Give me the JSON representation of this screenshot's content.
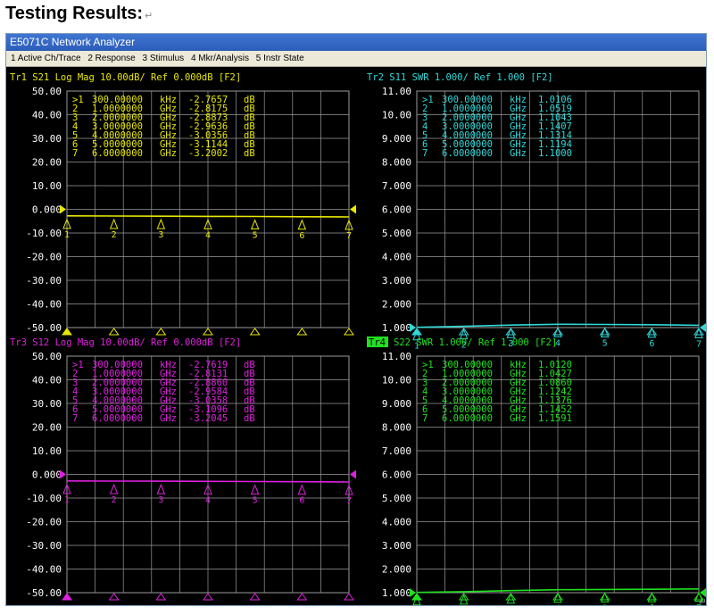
{
  "page": {
    "heading": "Testing Results:",
    "return_mark": "↵"
  },
  "window": {
    "title": "E5071C Network Analyzer"
  },
  "menu": [
    "1 Active Ch/Trace",
    "2 Response",
    "3 Stimulus",
    "4 Mkr/Analysis",
    "5 Instr State"
  ],
  "colors": {
    "tr1": "#e8e800",
    "tr2": "#30d8d8",
    "tr3": "#e020e0",
    "tr4": "#20e020",
    "grid": "#9a9a9a",
    "axis_text": "#ffffff"
  },
  "panels": [
    {
      "id": "tr1",
      "label": "Tr1",
      "header": "Tr1 S21 Log Mag 10.00dB/ Ref 0.000dB [F2]",
      "yticks": [
        "50.00",
        "40.00",
        "30.00",
        "20.00",
        "10.00",
        "0.000",
        "-10.00",
        "-20.00",
        "-30.00",
        "-40.00",
        "-50.00"
      ],
      "ymin": -50,
      "ymax": 50,
      "ref": 0,
      "marker_values": [
        -2.7657,
        -2.8175,
        -2.8873,
        -2.9636,
        -3.0356,
        -3.1144,
        -3.2002
      ],
      "markers": [
        {
          "idx": ">1",
          "freq": "300.00000",
          "unit": "kHz",
          "val": "-2.7657",
          "vunit": "dB"
        },
        {
          "idx": "2",
          "freq": "1.0000000",
          "unit": "GHz",
          "val": "-2.8175",
          "vunit": "dB"
        },
        {
          "idx": "3",
          "freq": "2.0000000",
          "unit": "GHz",
          "val": "-2.8873",
          "vunit": "dB"
        },
        {
          "idx": "4",
          "freq": "3.0000000",
          "unit": "GHz",
          "val": "-2.9636",
          "vunit": "dB"
        },
        {
          "idx": "5",
          "freq": "4.0000000",
          "unit": "GHz",
          "val": "-3.0356",
          "vunit": "dB"
        },
        {
          "idx": "6",
          "freq": "5.0000000",
          "unit": "GHz",
          "val": "-3.1144",
          "vunit": "dB"
        },
        {
          "idx": "7",
          "freq": "6.0000000",
          "unit": "GHz",
          "val": "-3.2002",
          "vunit": "dB"
        }
      ]
    },
    {
      "id": "tr2",
      "label": "Tr2",
      "header": "Tr2 S11 SWR 1.000/ Ref 1.000 [F2]",
      "yticks": [
        "11.00",
        "10.00",
        "9.000",
        "8.000",
        "7.000",
        "6.000",
        "5.000",
        "4.000",
        "3.000",
        "2.000",
        "1.000"
      ],
      "ymin": 1,
      "ymax": 11,
      "ref": 1,
      "marker_values": [
        1.0106,
        1.0519,
        1.1043,
        1.1407,
        1.1314,
        1.1194,
        1.1
      ],
      "markers": [
        {
          "idx": ">1",
          "freq": "300.00000",
          "unit": "kHz",
          "val": "1.0106",
          "vunit": ""
        },
        {
          "idx": "2",
          "freq": "1.0000000",
          "unit": "GHz",
          "val": "1.0519",
          "vunit": ""
        },
        {
          "idx": "3",
          "freq": "2.0000000",
          "unit": "GHz",
          "val": "1.1043",
          "vunit": ""
        },
        {
          "idx": "4",
          "freq": "3.0000000",
          "unit": "GHz",
          "val": "1.1407",
          "vunit": ""
        },
        {
          "idx": "5",
          "freq": "4.0000000",
          "unit": "GHz",
          "val": "1.1314",
          "vunit": ""
        },
        {
          "idx": "6",
          "freq": "5.0000000",
          "unit": "GHz",
          "val": "1.1194",
          "vunit": ""
        },
        {
          "idx": "7",
          "freq": "6.0000000",
          "unit": "GHz",
          "val": "1.1000",
          "vunit": ""
        }
      ]
    },
    {
      "id": "tr3",
      "label": "Tr3",
      "header": "Tr3 S12 Log Mag 10.00dB/ Ref 0.000dB [F2]",
      "yticks": [
        "50.00",
        "40.00",
        "30.00",
        "20.00",
        "10.00",
        "0.000",
        "-10.00",
        "-20.00",
        "-30.00",
        "-40.00",
        "-50.00"
      ],
      "ymin": -50,
      "ymax": 50,
      "ref": 0,
      "marker_values": [
        -2.7619,
        -2.8131,
        -2.886,
        -2.9584,
        -3.0358,
        -3.1096,
        -3.2045
      ],
      "markers": [
        {
          "idx": ">1",
          "freq": "300.00000",
          "unit": "kHz",
          "val": "-2.7619",
          "vunit": "dB"
        },
        {
          "idx": "2",
          "freq": "1.0000000",
          "unit": "GHz",
          "val": "-2.8131",
          "vunit": "dB"
        },
        {
          "idx": "3",
          "freq": "2.0000000",
          "unit": "GHz",
          "val": "-2.8860",
          "vunit": "dB"
        },
        {
          "idx": "4",
          "freq": "3.0000000",
          "unit": "GHz",
          "val": "-2.9584",
          "vunit": "dB"
        },
        {
          "idx": "5",
          "freq": "4.0000000",
          "unit": "GHz",
          "val": "-3.0358",
          "vunit": "dB"
        },
        {
          "idx": "6",
          "freq": "5.0000000",
          "unit": "GHz",
          "val": "-3.1096",
          "vunit": "dB"
        },
        {
          "idx": "7",
          "freq": "6.0000000",
          "unit": "GHz",
          "val": "-3.2045",
          "vunit": "dB"
        }
      ]
    },
    {
      "id": "tr4",
      "label": "Tr4",
      "header": "S22 SWR 1.000/ Ref 1.000 [F2]",
      "yticks": [
        "11.00",
        "10.00",
        "9.000",
        "8.000",
        "7.000",
        "6.000",
        "5.000",
        "4.000",
        "3.000",
        "2.000",
        "1.000"
      ],
      "ymin": 1,
      "ymax": 11,
      "ref": 1,
      "marker_values": [
        1.012,
        1.0427,
        1.086,
        1.1242,
        1.1376,
        1.1452,
        1.1591
      ],
      "markers": [
        {
          "idx": ">1",
          "freq": "300.00000",
          "unit": "kHz",
          "val": "1.0120",
          "vunit": ""
        },
        {
          "idx": "2",
          "freq": "1.0000000",
          "unit": "GHz",
          "val": "1.0427",
          "vunit": ""
        },
        {
          "idx": "3",
          "freq": "2.0000000",
          "unit": "GHz",
          "val": "1.0860",
          "vunit": ""
        },
        {
          "idx": "4",
          "freq": "3.0000000",
          "unit": "GHz",
          "val": "1.1242",
          "vunit": ""
        },
        {
          "idx": "5",
          "freq": "4.0000000",
          "unit": "GHz",
          "val": "1.1376",
          "vunit": ""
        },
        {
          "idx": "6",
          "freq": "5.0000000",
          "unit": "GHz",
          "val": "1.1452",
          "vunit": ""
        },
        {
          "idx": "7",
          "freq": "6.0000000",
          "unit": "GHz",
          "val": "1.1591",
          "vunit": ""
        }
      ]
    }
  ]
}
